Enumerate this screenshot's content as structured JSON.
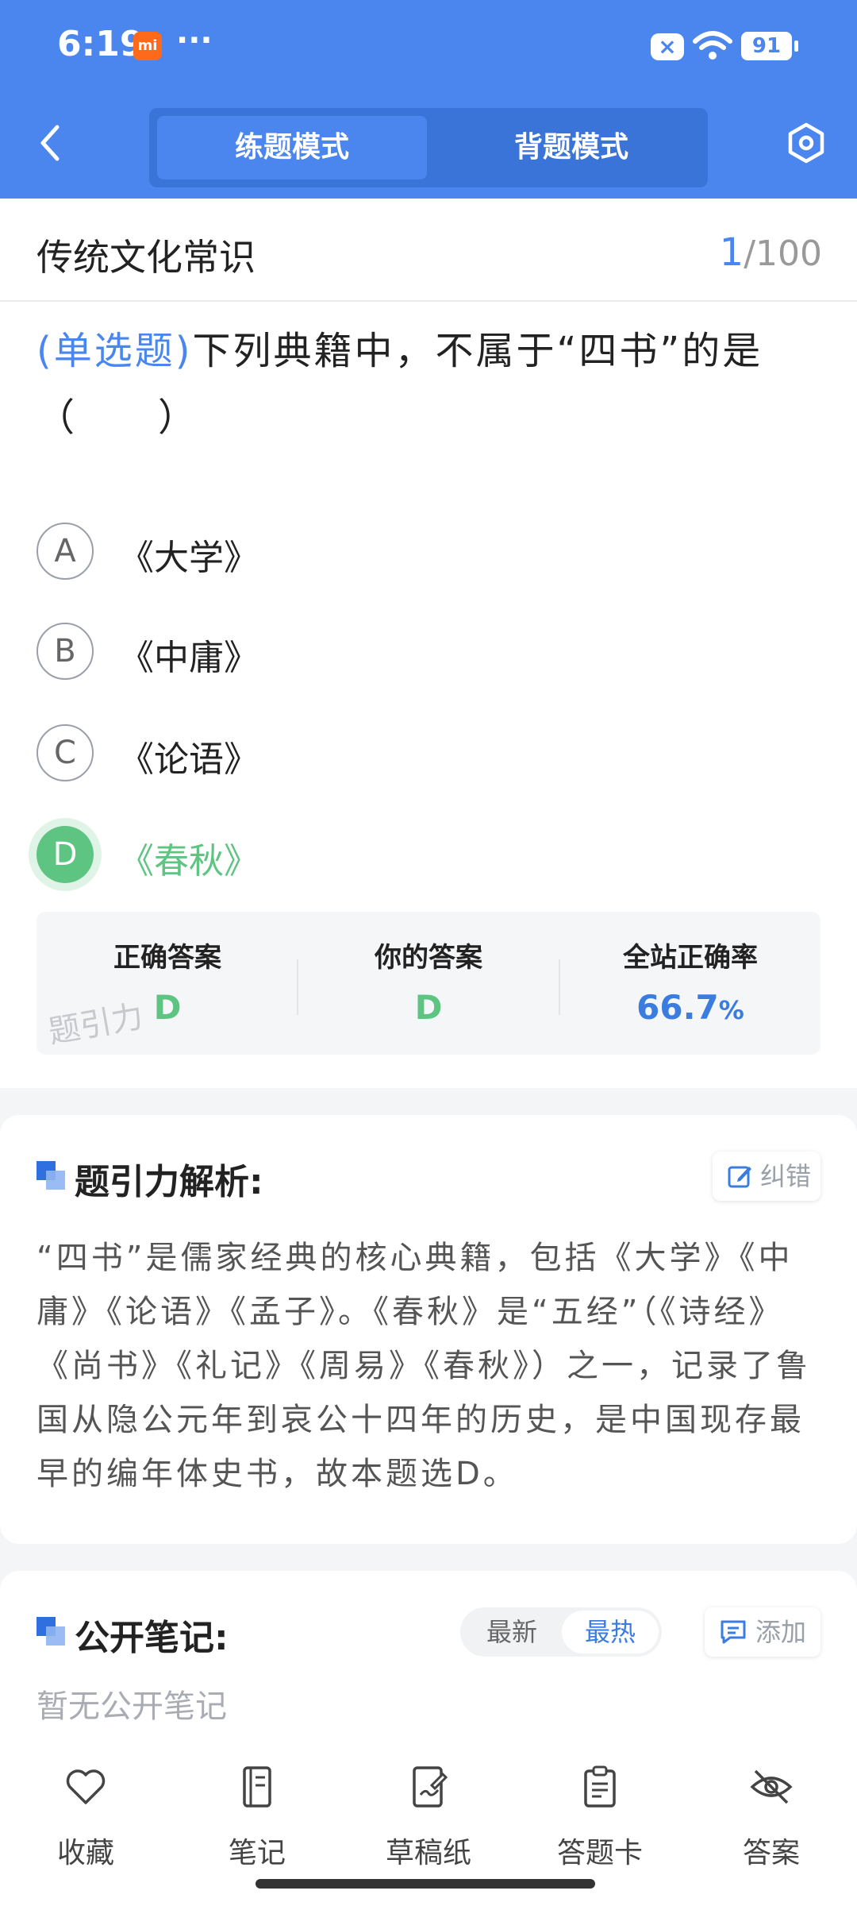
{
  "status": {
    "time": "6:19",
    "app_badge": "mi",
    "more": "···",
    "battery": "91"
  },
  "nav": {
    "mode_tabs": [
      "练题模式",
      "背题模式"
    ],
    "active_tab": "练题模式"
  },
  "question": {
    "topic": "传统文化常识",
    "current": "1",
    "total": "/100",
    "type_label": "(单选题)",
    "text": "下列典籍中，不属于“四书”的是（　　）",
    "options": [
      {
        "letter": "A",
        "text": "《大学》"
      },
      {
        "letter": "B",
        "text": "《中庸》"
      },
      {
        "letter": "C",
        "text": "《论语》"
      },
      {
        "letter": "D",
        "text": "《春秋》"
      }
    ],
    "selected": "D"
  },
  "result": {
    "correct_label": "正确答案",
    "correct_value": "D",
    "yours_label": "你的答案",
    "yours_value": "D",
    "rate_label": "全站正确率",
    "rate_value": "66.7",
    "rate_unit": "%",
    "watermark": "题引力"
  },
  "analysis": {
    "title": "题引力解析:",
    "feedback_label": "纠错",
    "text": "“四书”是儒家经典的核心典籍，包括《大学》《中庸》《论语》《孟子》。《春秋》是“五经”（《诗经》《尚书》《礼记》《周易》《春秋》）之一，记录了鲁国从隐公元年到哀公十四年的历史，是中国现存最早的编年体史书，故本题选D。"
  },
  "notes": {
    "title": "公开笔记:",
    "sort_options": [
      "最新",
      "最热"
    ],
    "active_sort": "最热",
    "add_label": "添加",
    "empty_text": "暂无公开笔记"
  },
  "toolbar": {
    "items": [
      {
        "label": "收藏",
        "icon": "heart-icon"
      },
      {
        "label": "笔记",
        "icon": "notebook-icon"
      },
      {
        "label": "草稿纸",
        "icon": "draft-icon"
      },
      {
        "label": "答题卡",
        "icon": "answer-sheet-icon"
      },
      {
        "label": "答案",
        "icon": "eye-off-icon"
      }
    ]
  },
  "colors": {
    "brand_blue": "#4a86ee",
    "correct_green": "#5ec482"
  }
}
